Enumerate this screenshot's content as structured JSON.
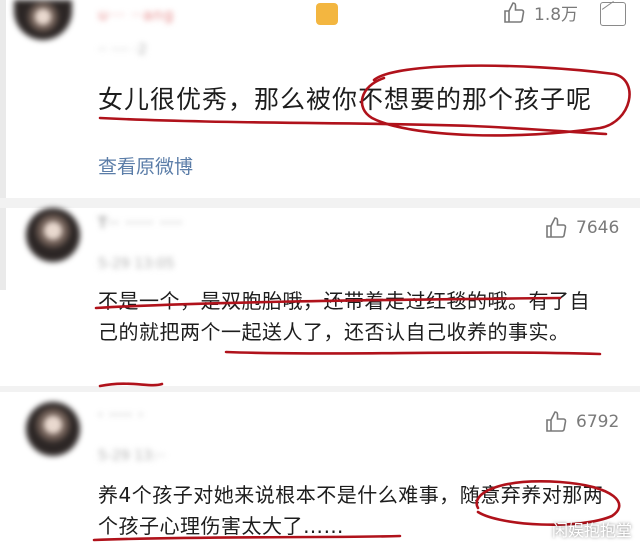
{
  "post": {
    "username": "u··· ··ang",
    "timestamp": "·· ···· ·2",
    "likes": "1.8万",
    "body": "女儿很优秀，那么被你不想要的那个孩子呢",
    "view_original": "查看原微博"
  },
  "comments": [
    {
      "username": "T·· ····· ····",
      "timestamp": "5-29 13:05",
      "likes": "7646",
      "body": "不是一个，是双胞胎哦，还带着走过红毯的哦。有了自己的就把两个一起送人了，还否认自己收养的事实。"
    },
    {
      "username": "· ···· ·",
      "timestamp": "5-29 13:··",
      "likes": "6792",
      "body": "养4个孩子对她来说根本不是什么难事，随意弃养对那两个孩子心理伤害太大了……"
    }
  ],
  "watermark": "闲娱抱抱堂",
  "colors": {
    "annotation": "#b0121b",
    "link": "#5b7da8",
    "muted": "#b0b0b0"
  }
}
